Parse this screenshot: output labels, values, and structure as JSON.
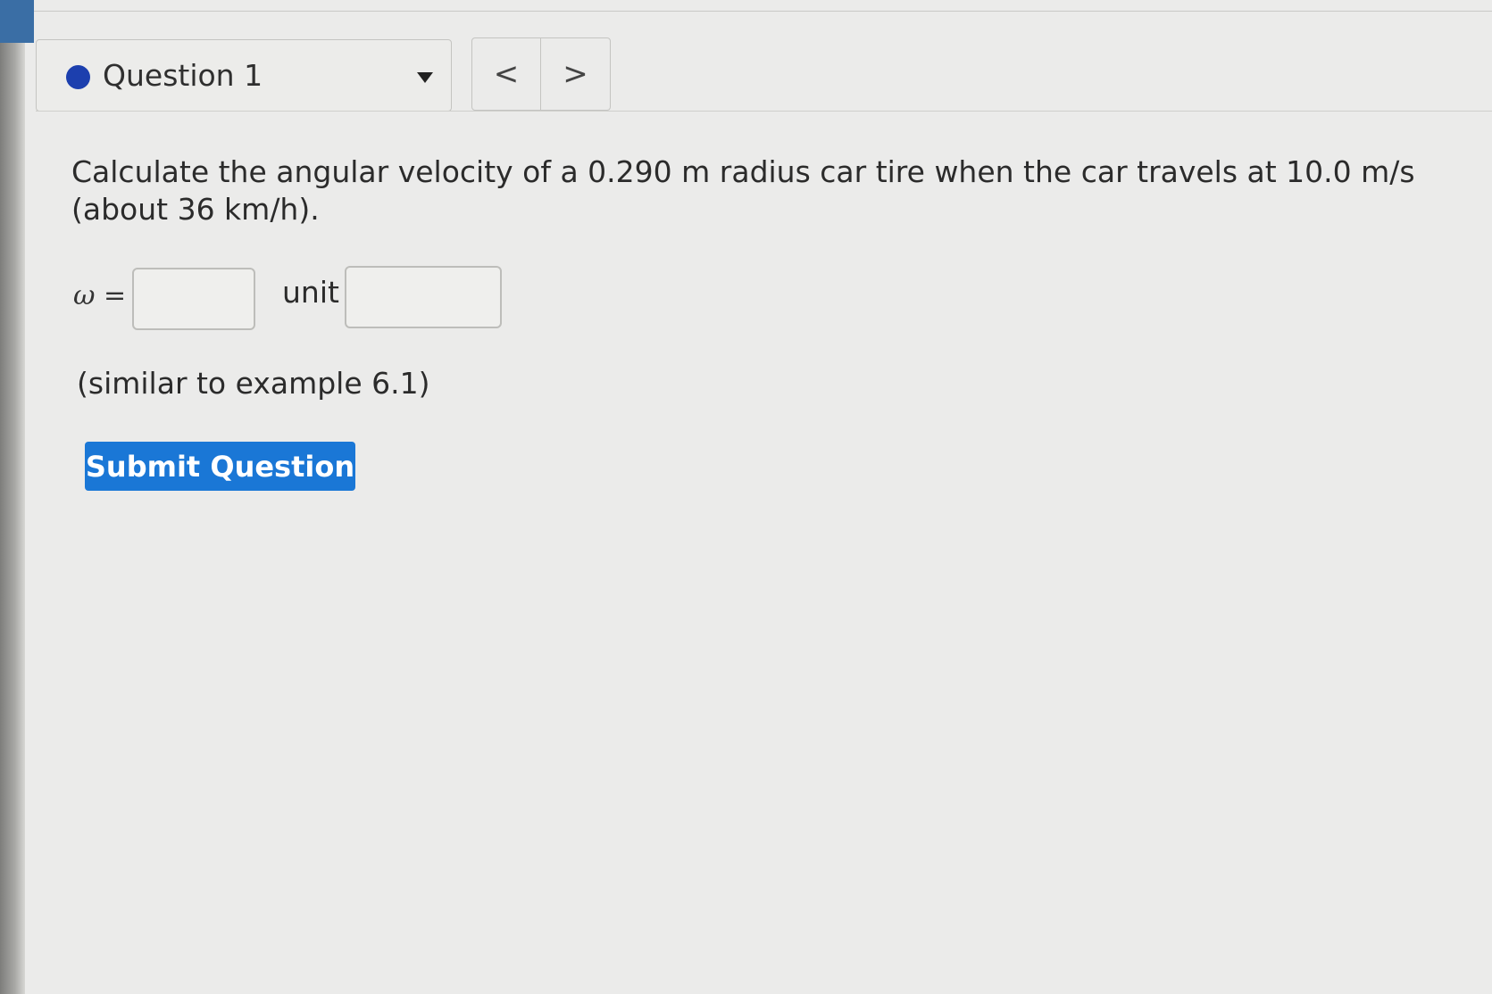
{
  "question_nav": {
    "title": "Question 1",
    "prev_icon": "chevron-left-icon",
    "next_icon": "chevron-right-icon",
    "prev_glyph": "<",
    "next_glyph": ">"
  },
  "question": {
    "text": "Calculate the angular velocity of a 0.290 m radius car tire when the car travels at 10.0 m/s (about 36 km/h).",
    "omega_label": "ω =",
    "answer_value": "",
    "unit_label": "unit",
    "unit_value": "",
    "hint": "(similar to example 6.1)"
  },
  "actions": {
    "submit_label": "Submit Question"
  },
  "colors": {
    "status_dot": "#1c3fae",
    "submit_bg": "#1a77d6",
    "corner_tab": "#3a6ea5"
  }
}
